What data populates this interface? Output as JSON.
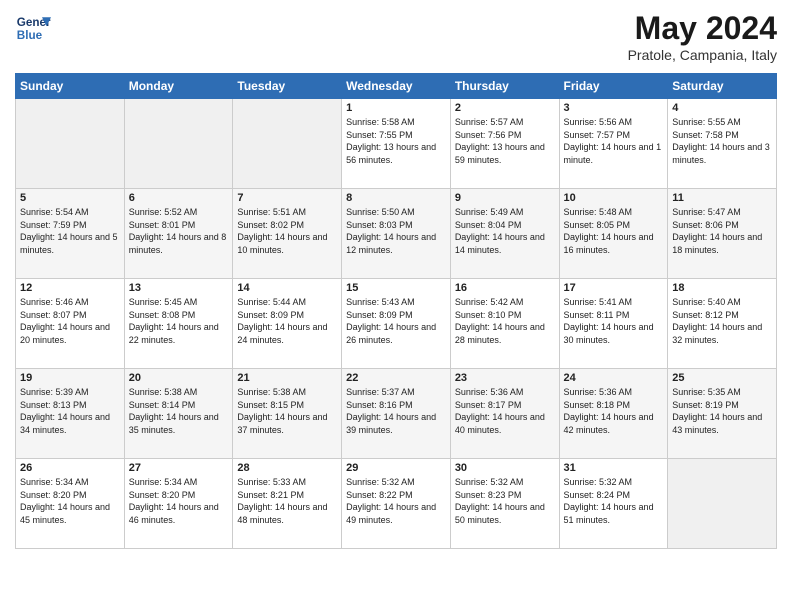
{
  "header": {
    "logo_line1": "General",
    "logo_line2": "Blue",
    "title": "May 2024",
    "subtitle": "Pratole, Campania, Italy"
  },
  "weekdays": [
    "Sunday",
    "Monday",
    "Tuesday",
    "Wednesday",
    "Thursday",
    "Friday",
    "Saturday"
  ],
  "weeks": [
    [
      {
        "day": "",
        "empty": true
      },
      {
        "day": "",
        "empty": true
      },
      {
        "day": "",
        "empty": true
      },
      {
        "day": "1",
        "sunrise": "5:58 AM",
        "sunset": "7:55 PM",
        "daylight": "13 hours and 56 minutes."
      },
      {
        "day": "2",
        "sunrise": "5:57 AM",
        "sunset": "7:56 PM",
        "daylight": "13 hours and 59 minutes."
      },
      {
        "day": "3",
        "sunrise": "5:56 AM",
        "sunset": "7:57 PM",
        "daylight": "14 hours and 1 minute."
      },
      {
        "day": "4",
        "sunrise": "5:55 AM",
        "sunset": "7:58 PM",
        "daylight": "14 hours and 3 minutes."
      }
    ],
    [
      {
        "day": "5",
        "sunrise": "5:54 AM",
        "sunset": "7:59 PM",
        "daylight": "14 hours and 5 minutes."
      },
      {
        "day": "6",
        "sunrise": "5:52 AM",
        "sunset": "8:01 PM",
        "daylight": "14 hours and 8 minutes."
      },
      {
        "day": "7",
        "sunrise": "5:51 AM",
        "sunset": "8:02 PM",
        "daylight": "14 hours and 10 minutes."
      },
      {
        "day": "8",
        "sunrise": "5:50 AM",
        "sunset": "8:03 PM",
        "daylight": "14 hours and 12 minutes."
      },
      {
        "day": "9",
        "sunrise": "5:49 AM",
        "sunset": "8:04 PM",
        "daylight": "14 hours and 14 minutes."
      },
      {
        "day": "10",
        "sunrise": "5:48 AM",
        "sunset": "8:05 PM",
        "daylight": "14 hours and 16 minutes."
      },
      {
        "day": "11",
        "sunrise": "5:47 AM",
        "sunset": "8:06 PM",
        "daylight": "14 hours and 18 minutes."
      }
    ],
    [
      {
        "day": "12",
        "sunrise": "5:46 AM",
        "sunset": "8:07 PM",
        "daylight": "14 hours and 20 minutes."
      },
      {
        "day": "13",
        "sunrise": "5:45 AM",
        "sunset": "8:08 PM",
        "daylight": "14 hours and 22 minutes."
      },
      {
        "day": "14",
        "sunrise": "5:44 AM",
        "sunset": "8:09 PM",
        "daylight": "14 hours and 24 minutes."
      },
      {
        "day": "15",
        "sunrise": "5:43 AM",
        "sunset": "8:09 PM",
        "daylight": "14 hours and 26 minutes."
      },
      {
        "day": "16",
        "sunrise": "5:42 AM",
        "sunset": "8:10 PM",
        "daylight": "14 hours and 28 minutes."
      },
      {
        "day": "17",
        "sunrise": "5:41 AM",
        "sunset": "8:11 PM",
        "daylight": "14 hours and 30 minutes."
      },
      {
        "day": "18",
        "sunrise": "5:40 AM",
        "sunset": "8:12 PM",
        "daylight": "14 hours and 32 minutes."
      }
    ],
    [
      {
        "day": "19",
        "sunrise": "5:39 AM",
        "sunset": "8:13 PM",
        "daylight": "14 hours and 34 minutes."
      },
      {
        "day": "20",
        "sunrise": "5:38 AM",
        "sunset": "8:14 PM",
        "daylight": "14 hours and 35 minutes."
      },
      {
        "day": "21",
        "sunrise": "5:38 AM",
        "sunset": "8:15 PM",
        "daylight": "14 hours and 37 minutes."
      },
      {
        "day": "22",
        "sunrise": "5:37 AM",
        "sunset": "8:16 PM",
        "daylight": "14 hours and 39 minutes."
      },
      {
        "day": "23",
        "sunrise": "5:36 AM",
        "sunset": "8:17 PM",
        "daylight": "14 hours and 40 minutes."
      },
      {
        "day": "24",
        "sunrise": "5:36 AM",
        "sunset": "8:18 PM",
        "daylight": "14 hours and 42 minutes."
      },
      {
        "day": "25",
        "sunrise": "5:35 AM",
        "sunset": "8:19 PM",
        "daylight": "14 hours and 43 minutes."
      }
    ],
    [
      {
        "day": "26",
        "sunrise": "5:34 AM",
        "sunset": "8:20 PM",
        "daylight": "14 hours and 45 minutes."
      },
      {
        "day": "27",
        "sunrise": "5:34 AM",
        "sunset": "8:20 PM",
        "daylight": "14 hours and 46 minutes."
      },
      {
        "day": "28",
        "sunrise": "5:33 AM",
        "sunset": "8:21 PM",
        "daylight": "14 hours and 48 minutes."
      },
      {
        "day": "29",
        "sunrise": "5:32 AM",
        "sunset": "8:22 PM",
        "daylight": "14 hours and 49 minutes."
      },
      {
        "day": "30",
        "sunrise": "5:32 AM",
        "sunset": "8:23 PM",
        "daylight": "14 hours and 50 minutes."
      },
      {
        "day": "31",
        "sunrise": "5:32 AM",
        "sunset": "8:24 PM",
        "daylight": "14 hours and 51 minutes."
      },
      {
        "day": "",
        "empty": true
      }
    ]
  ]
}
